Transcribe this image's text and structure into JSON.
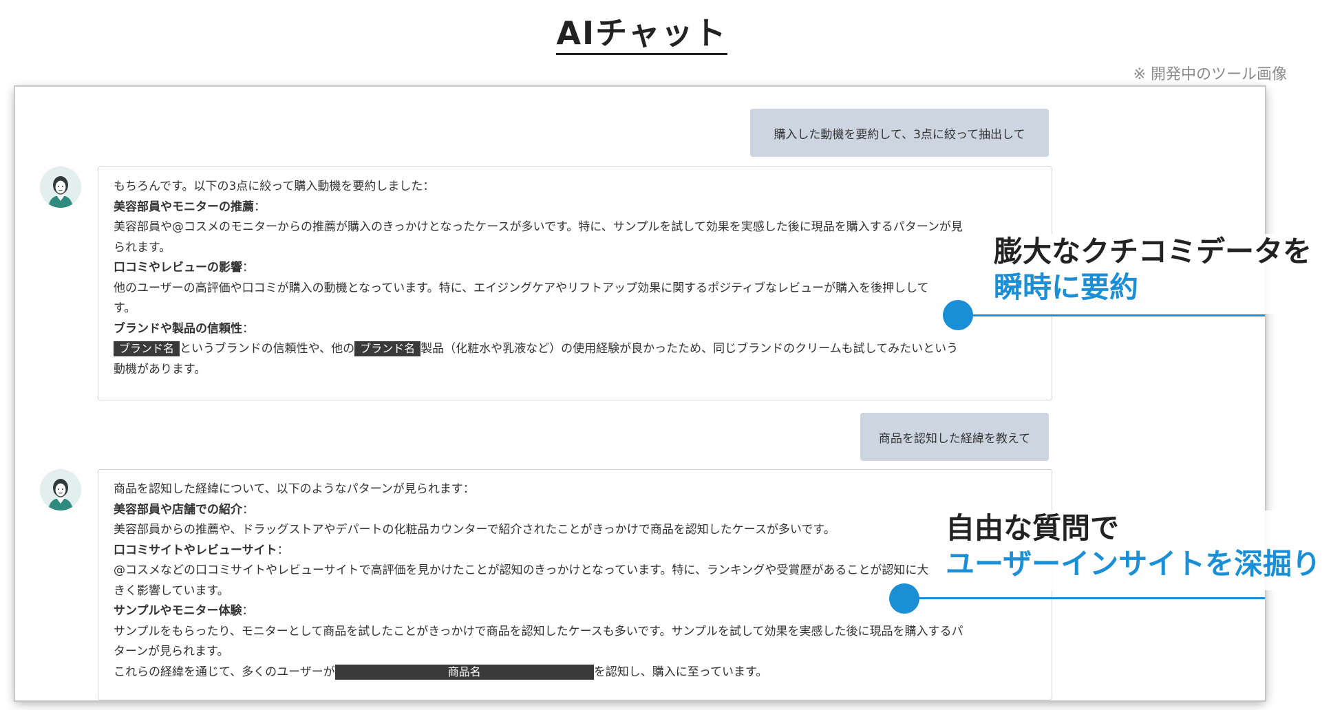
{
  "page_title": "AIチャット",
  "note": "※ 開発中のツール画像",
  "colors": {
    "accent": "#1a8fd6",
    "user_bubble": "#cdd5e0",
    "redaction": "#3a3a3a"
  },
  "chat": {
    "user_message_1": "購入した動機を要約して、3点に絞って抽出して",
    "ai_message_1": {
      "intro": "もちろんです。以下の3点に絞って購入動機を要約しました：",
      "point1_heading": "美容部員やモニターの推薦",
      "point1_colon": "：",
      "point1_text_a": "美容部員や@コスメのモニターからの推薦が購入のきっかけとなったケースが多いです。特に、サンプルを試して効果を実感した後に現品を購入するパターンが見",
      "point1_text_b": "られます。",
      "point2_heading": "口コミやレビューの影響",
      "point2_colon": "：",
      "point2_text_a": "他のユーザーの高評価や口コミが購入の動機となっています。特に、エイジングケアやリフトアップ効果に関するポジティブなレビューが購入を後押しして",
      "point2_text_b": "す。",
      "point3_heading": "ブランドや製品の信頼性",
      "point3_colon": "：",
      "redact_brand_1": "ブランド名",
      "point3_text_a1": "というブランドの信頼性や、他の",
      "redact_brand_2": "ブランド名",
      "point3_text_a2": "製品（化粧水や乳液など）の使用経験が良かったため、同じブランドのクリームも試してみたいという",
      "point3_text_b": "動機があります。"
    },
    "user_message_2": "商品を認知した経緯を教えて",
    "ai_message_2": {
      "intro": "商品を認知した経緯について、以下のようなパターンが見られます：",
      "point1_heading": "美容部員や店舗での紹介",
      "point1_colon": "：",
      "point1_text": "美容部員からの推薦や、ドラッグストアやデパートの化粧品カウンターで紹介されたことがきっかけで商品を認知したケースが多いです。",
      "point2_heading": "口コミサイトやレビューサイト",
      "point2_colon": "：",
      "point2_text_a": "@コスメなどの口コミサイトやレビューサイトで高評価を見かけたことが認知のきっかけとなっています。特に、ランキングや受賞歴があることが認知に大",
      "point2_text_b": "きく影響しています。",
      "point3_heading": "サンプルやモニター体験",
      "point3_colon": "：",
      "point3_text_a": "サンプルをもらったり、モニターとして商品を試したことがきっかけで商品を認知したケースも多いです。サンプルを試して効果を実感した後に現品を購入するパ",
      "point3_text_b": "ターンが見られます。",
      "summary_pre": "これらの経緯を通じて、多くのユーザーが",
      "redact_product": "商品名",
      "summary_post": "を認知し、購入に至っています。"
    }
  },
  "callouts": {
    "callout_1_line1": "膨大なクチコミデータを",
    "callout_1_line2": "瞬時に要約",
    "callout_2_line1": "自由な質問で",
    "callout_2_line2": "ユーザーインサイトを深掘り"
  }
}
